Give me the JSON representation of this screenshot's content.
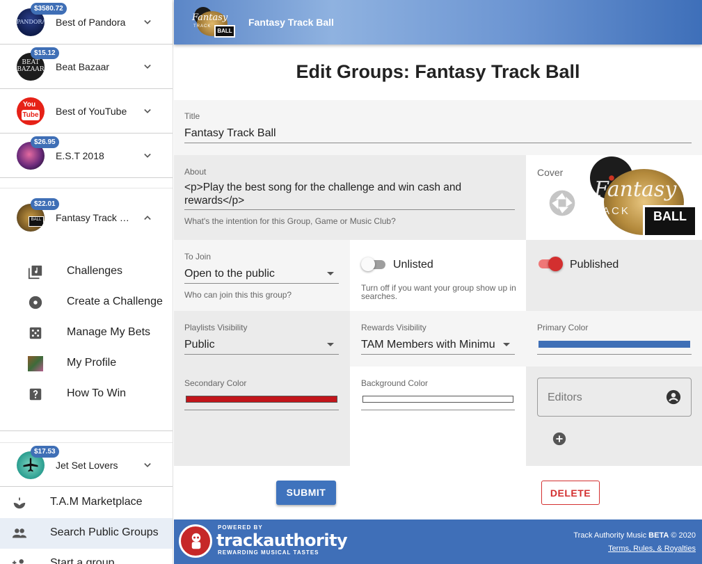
{
  "sidebar": {
    "groups_top": [
      {
        "name": "Best of Pandora",
        "badge": "$3580.72"
      },
      {
        "name": "Beat Bazaar",
        "badge": "$15.12"
      },
      {
        "name": "Best of YouTube",
        "badge": ""
      },
      {
        "name": "E.S.T 2018",
        "badge": "$26.95"
      }
    ],
    "active_group": {
      "name": "Fantasy Track Ball",
      "badge": "$22.01"
    },
    "submenu": [
      {
        "label": "Challenges",
        "icon": "playlist-add-icon"
      },
      {
        "label": "Create a Challenge",
        "icon": "disc-icon"
      },
      {
        "label": "Manage My Bets",
        "icon": "dice-icon"
      },
      {
        "label": "My Profile",
        "icon": "profile-image-icon"
      },
      {
        "label": "How To Win",
        "icon": "help-icon"
      }
    ],
    "last_group": {
      "name": "Jet Set Lovers",
      "badge": "$17.53"
    },
    "nav": [
      {
        "label": "T.A.M Marketplace",
        "icon": "marketplace-icon"
      },
      {
        "label": "Search Public Groups",
        "icon": "people-icon"
      },
      {
        "label": "Start a group",
        "icon": "group-add-icon"
      }
    ]
  },
  "header": {
    "title": "Fantasy Track Ball"
  },
  "page": {
    "title": "Edit Groups: Fantasy Track Ball"
  },
  "form": {
    "title_label": "Title",
    "title_value": "Fantasy Track Ball",
    "about_label": "About",
    "about_value": "<p>Play the best song for the challenge and win cash and rewards</p>",
    "about_hint": "What's the intention for this Group, Game or Music Club?",
    "cover_label": "Cover",
    "join_label": "To Join",
    "join_value": "Open to the public",
    "join_hint": "Who can join this this group?",
    "unlisted_label": "Unlisted",
    "unlisted_hint": "Turn off if you want your group show up in searches.",
    "published_label": "Published",
    "playlists_label": "Playlists Visibility",
    "playlists_value": "Public",
    "rewards_label": "Rewards Visibility",
    "rewards_value": "TAM Members with Minimu",
    "primary_label": "Primary Color",
    "secondary_label": "Secondary Color",
    "background_label": "Background Color",
    "editors_placeholder": "Editors",
    "submit_label": "SUBMIT",
    "delete_label": "DELETE"
  },
  "colors": {
    "primary": "#3f6fb6",
    "secondary": "#c2151b",
    "background": "#ffffff",
    "accent_red": "#d32f2f"
  },
  "toggles": {
    "unlisted": false,
    "published": true
  },
  "footer": {
    "powered_by": "POWERED BY",
    "brand": "trackauthority",
    "tagline": "REWARDING MUSICAL TASTES",
    "copyright_prefix": "Track Authority Music",
    "copyright_beta": "BETA",
    "copyright_suffix": "© 2020",
    "terms": "Terms, Rules, & Royalties"
  },
  "logo": {
    "top": "Fantasy",
    "mid": "TRACK",
    "ball": "BALL"
  }
}
